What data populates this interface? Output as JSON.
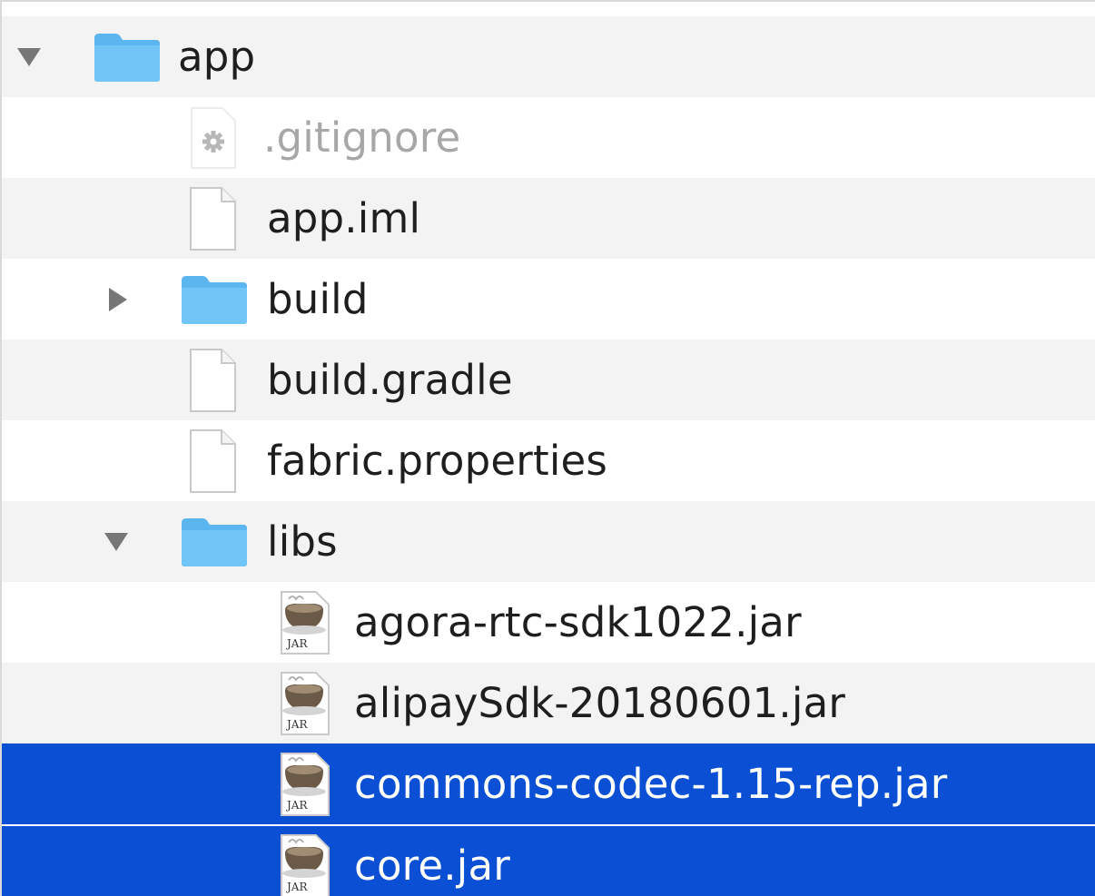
{
  "colors": {
    "selection": "#0a4fd4",
    "folder": "#5bb5ef",
    "alt_row": "#f3f3f3"
  },
  "items": [
    {
      "label": "app",
      "icon": "folder-icon",
      "expanded": true
    },
    {
      "label": ".gitignore",
      "icon": "gear-file-icon",
      "muted": true
    },
    {
      "label": "app.iml",
      "icon": "document-icon"
    },
    {
      "label": "build",
      "icon": "folder-icon",
      "expanded": false
    },
    {
      "label": "build.gradle",
      "icon": "document-icon"
    },
    {
      "label": "fabric.properties",
      "icon": "document-icon"
    },
    {
      "label": "libs",
      "icon": "folder-icon",
      "expanded": true
    },
    {
      "label": "agora-rtc-sdk1022.jar",
      "icon": "jar-file-icon",
      "badge": "JAR"
    },
    {
      "label": "alipaySdk-20180601.jar",
      "icon": "jar-file-icon",
      "badge": "JAR"
    },
    {
      "label": "commons-codec-1.15-rep.jar",
      "icon": "jar-file-icon",
      "badge": "JAR",
      "selected": true
    },
    {
      "label": "core.jar",
      "icon": "jar-file-icon",
      "badge": "JAR",
      "selected": true
    }
  ]
}
